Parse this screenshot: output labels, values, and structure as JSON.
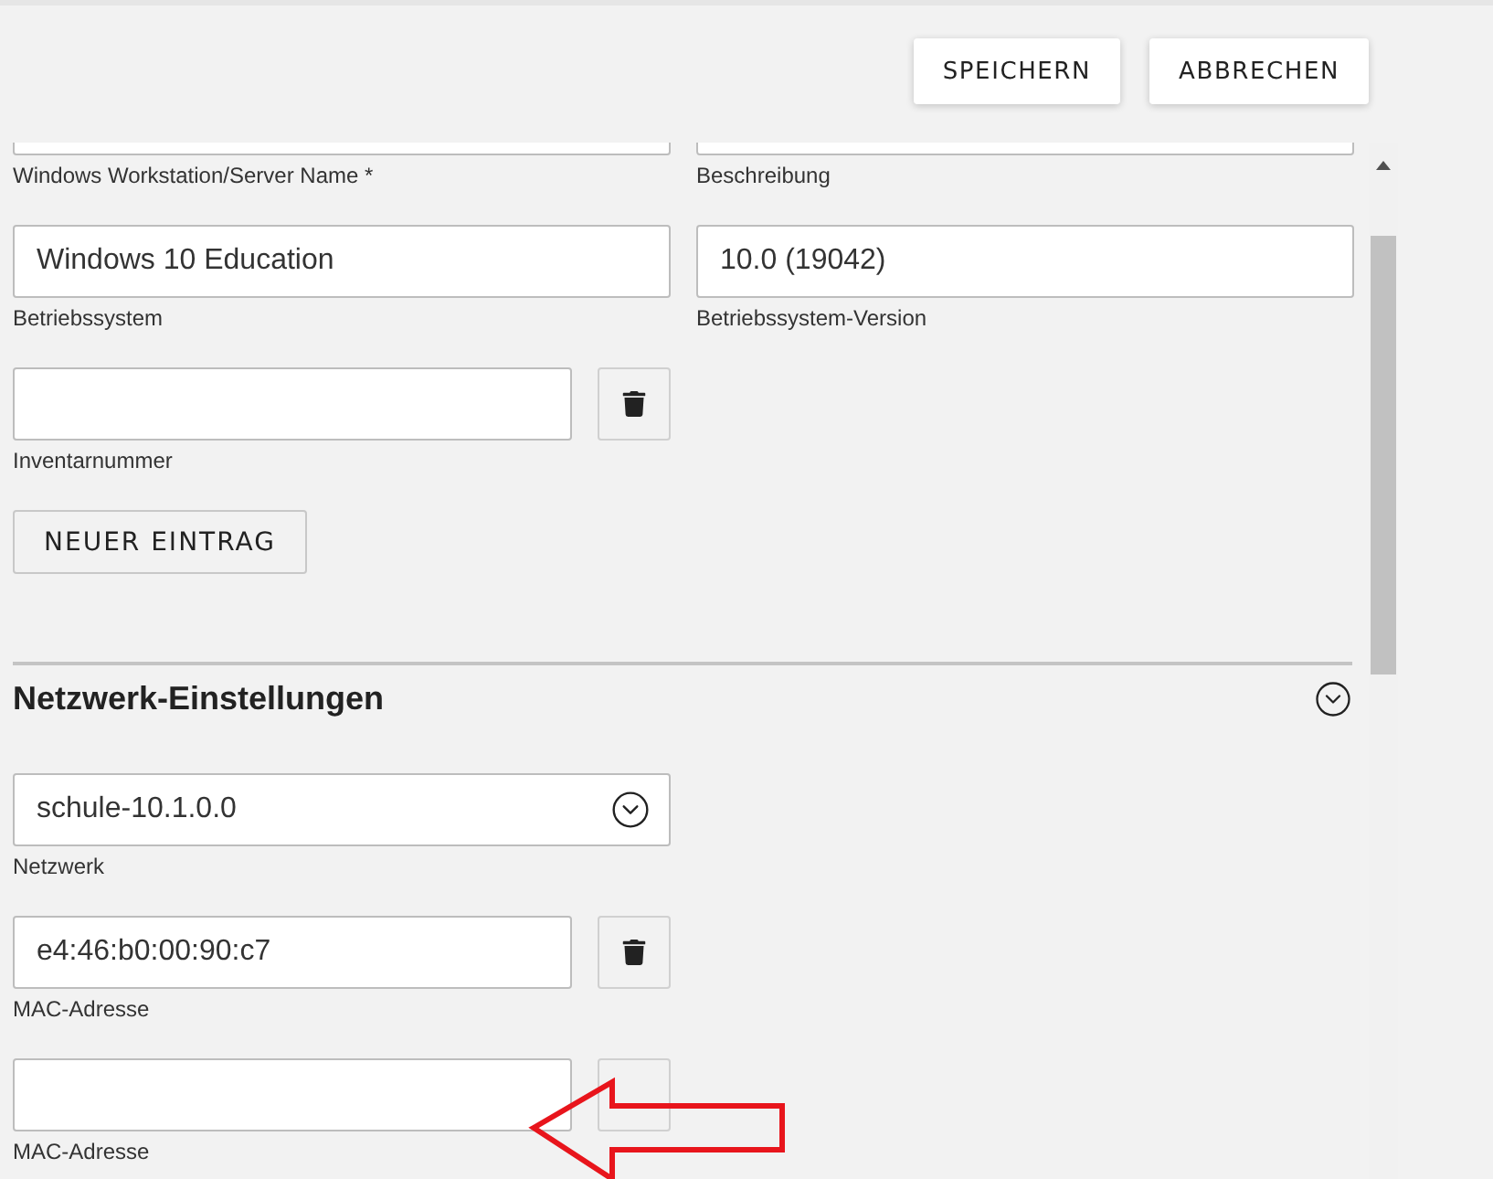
{
  "header_buttons": [
    "SPEICHERN",
    "ABBRECHEN"
  ],
  "general_rows": [
    {
      "fields": [
        {
          "label": "Windows Workstation/Server Name *"
        },
        {
          "label": "Beschreibung"
        }
      ]
    },
    {
      "fields": [
        {
          "label": "Betriebssystem",
          "value": "Windows 10 Education"
        },
        {
          "label": "Betriebssystem-Version",
          "value": "10.0 (19042)"
        }
      ]
    }
  ],
  "inventory": [
    {
      "label": "Inventarnummer",
      "delete_icon_visible": true
    }
  ],
  "new_entry_button": "NEUER EINTRAG",
  "network_section": {
    "title": "Netzwerk-Einstellungen",
    "expanded": true,
    "network_select": {
      "label": "Netzwerk",
      "value": "schule-10.1.0.0"
    },
    "mac_addresses": [
      {
        "label": "MAC-Adresse",
        "value": "e4:46:b0:00:90:c7",
        "delete_icon_visible": true
      },
      {
        "label": "MAC-Adresse",
        "delete_icon_visible": false
      }
    ]
  }
}
